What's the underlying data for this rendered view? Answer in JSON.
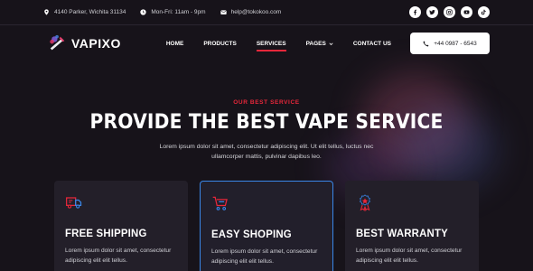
{
  "topbar": {
    "address": "4140 Parker, Wichita 31134",
    "hours": "Mon-Fri: 11am - 9pm",
    "email": "help@tokokoo.com",
    "socials": [
      "facebook-icon",
      "twitter-icon",
      "instagram-icon",
      "youtube-icon",
      "tiktok-icon"
    ]
  },
  "nav": {
    "logo_text": "VAPIXO",
    "items": [
      {
        "label": "HOME"
      },
      {
        "label": "PRODUCTS"
      },
      {
        "label": "SERVICES"
      },
      {
        "label": "PAGES"
      },
      {
        "label": "CONTACT US"
      }
    ],
    "active": "SERVICES",
    "phone": "+44 0987 - 6543"
  },
  "hero": {
    "subtitle": "OUR BEST SERVICE",
    "headline": "PROVIDE THE BEST VAPE SERVICE",
    "description": "Lorem ipsum dolor sit amet, consectetur adipiscing elit. Ut elit tellus, luctus nec ullamcorper mattis, pulvinar dapibus leo."
  },
  "cards": [
    {
      "icon": "truck-icon",
      "title": "FREE SHIPPING",
      "text": "Lorem ipsum dolor sit amet, consectetur adipiscing elit elit tellus."
    },
    {
      "icon": "cart-icon",
      "title": "EASY SHOPING",
      "text": "Lorem ipsum dolor sit amet, consectetur adipiscing elit elit tellus."
    },
    {
      "icon": "medal-icon",
      "title": "BEST WARRANTY",
      "text": "Lorem ipsum dolor sit amet, consectetur adipiscing elit elit tellus."
    }
  ],
  "colors": {
    "background": "#17131a",
    "accent": "#e8273a",
    "card": "#231f29",
    "featured_border": "#3a86e8"
  }
}
